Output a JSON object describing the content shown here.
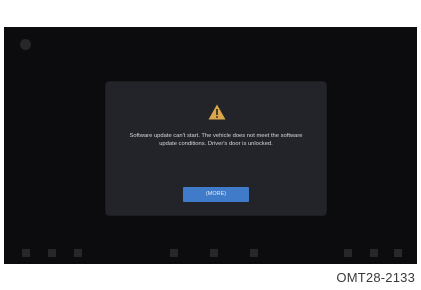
{
  "colors": {
    "screen_background": "#0c0c0e",
    "dialog_background": "#232429",
    "button_accent": "#3f7bc8",
    "warning_icon": "#d9a64a"
  },
  "status_bar": {
    "title": "",
    "middle": "",
    "right": ""
  },
  "dialog": {
    "icon": "warning-triangle-icon",
    "message": "Software update can't start. The vehicle does not meet the software update conditions. Driver's door is unlocked.",
    "ok_label": "(MORE)"
  },
  "caption": "OMT28-2133"
}
